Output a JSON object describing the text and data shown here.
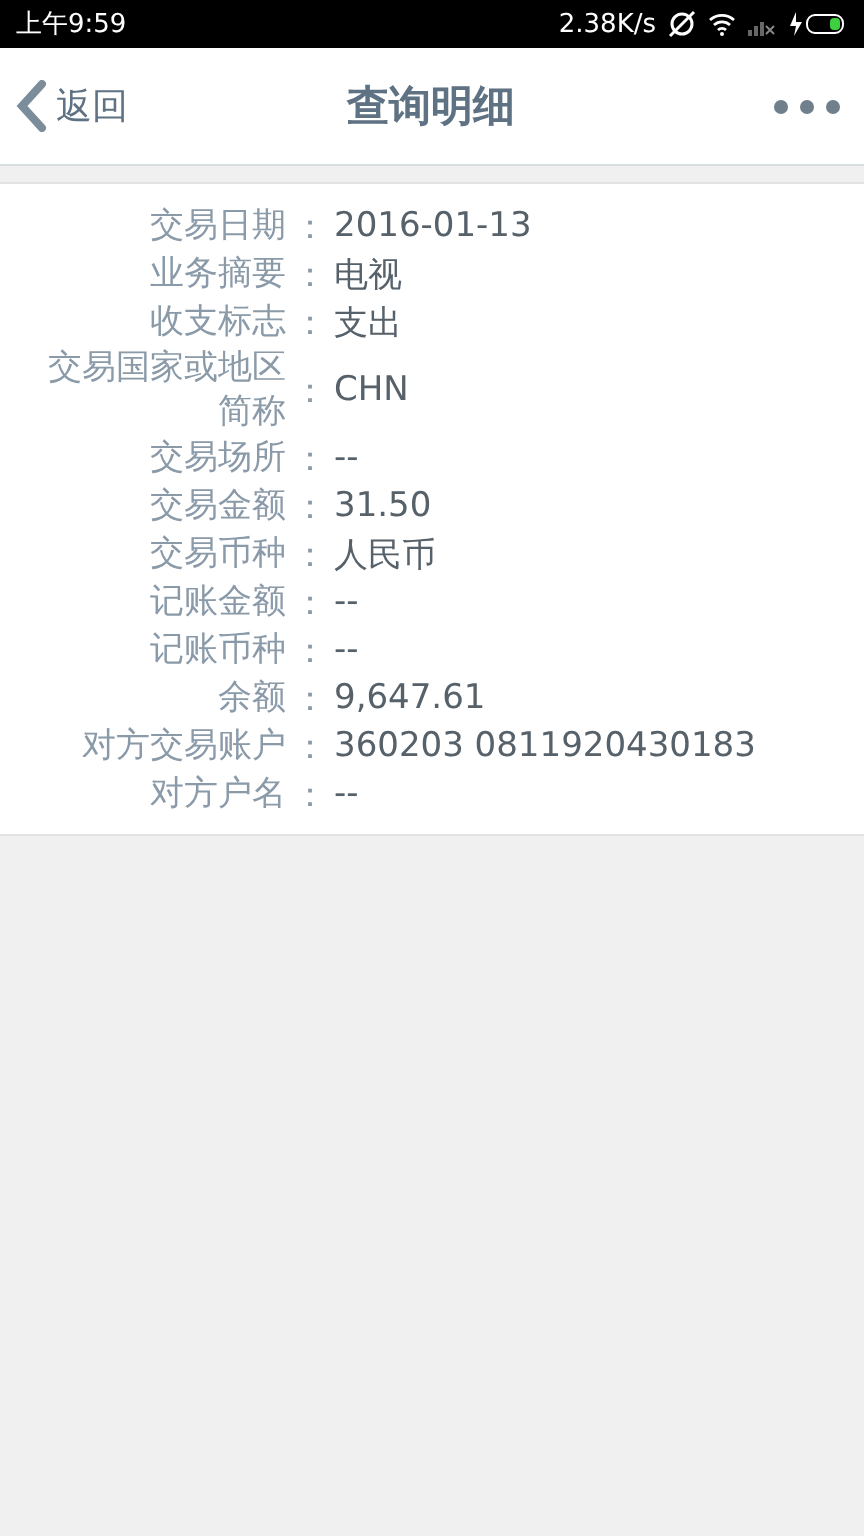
{
  "status_bar": {
    "time": "上午9:59",
    "speed": "2.38K/s"
  },
  "header": {
    "back": "返回",
    "title": "查询明细"
  },
  "details": [
    {
      "label": "交易日期",
      "separator": "：",
      "value": "2016-01-13"
    },
    {
      "label": "业务摘要",
      "separator": "：",
      "value": "电视"
    },
    {
      "label": "收支标志",
      "separator": "：",
      "value": "支出"
    },
    {
      "label": "交易国家或地区简称",
      "separator": "：",
      "value": "CHN"
    },
    {
      "label": "交易场所",
      "separator": "：",
      "value": "--"
    },
    {
      "label": "交易金额",
      "separator": "：",
      "value": "31.50"
    },
    {
      "label": "交易币种",
      "separator": "：",
      "value": "人民币"
    },
    {
      "label": "记账金额",
      "separator": "：",
      "value": "--"
    },
    {
      "label": "记账币种",
      "separator": "：",
      "value": "--"
    },
    {
      "label": "余额",
      "separator": "：",
      "value": "9,647.61"
    },
    {
      "label": "对方交易账户",
      "separator": "：",
      "value": "360203 0811920430183"
    },
    {
      "label": "对方户名",
      "separator": "：",
      "value": "--"
    }
  ]
}
